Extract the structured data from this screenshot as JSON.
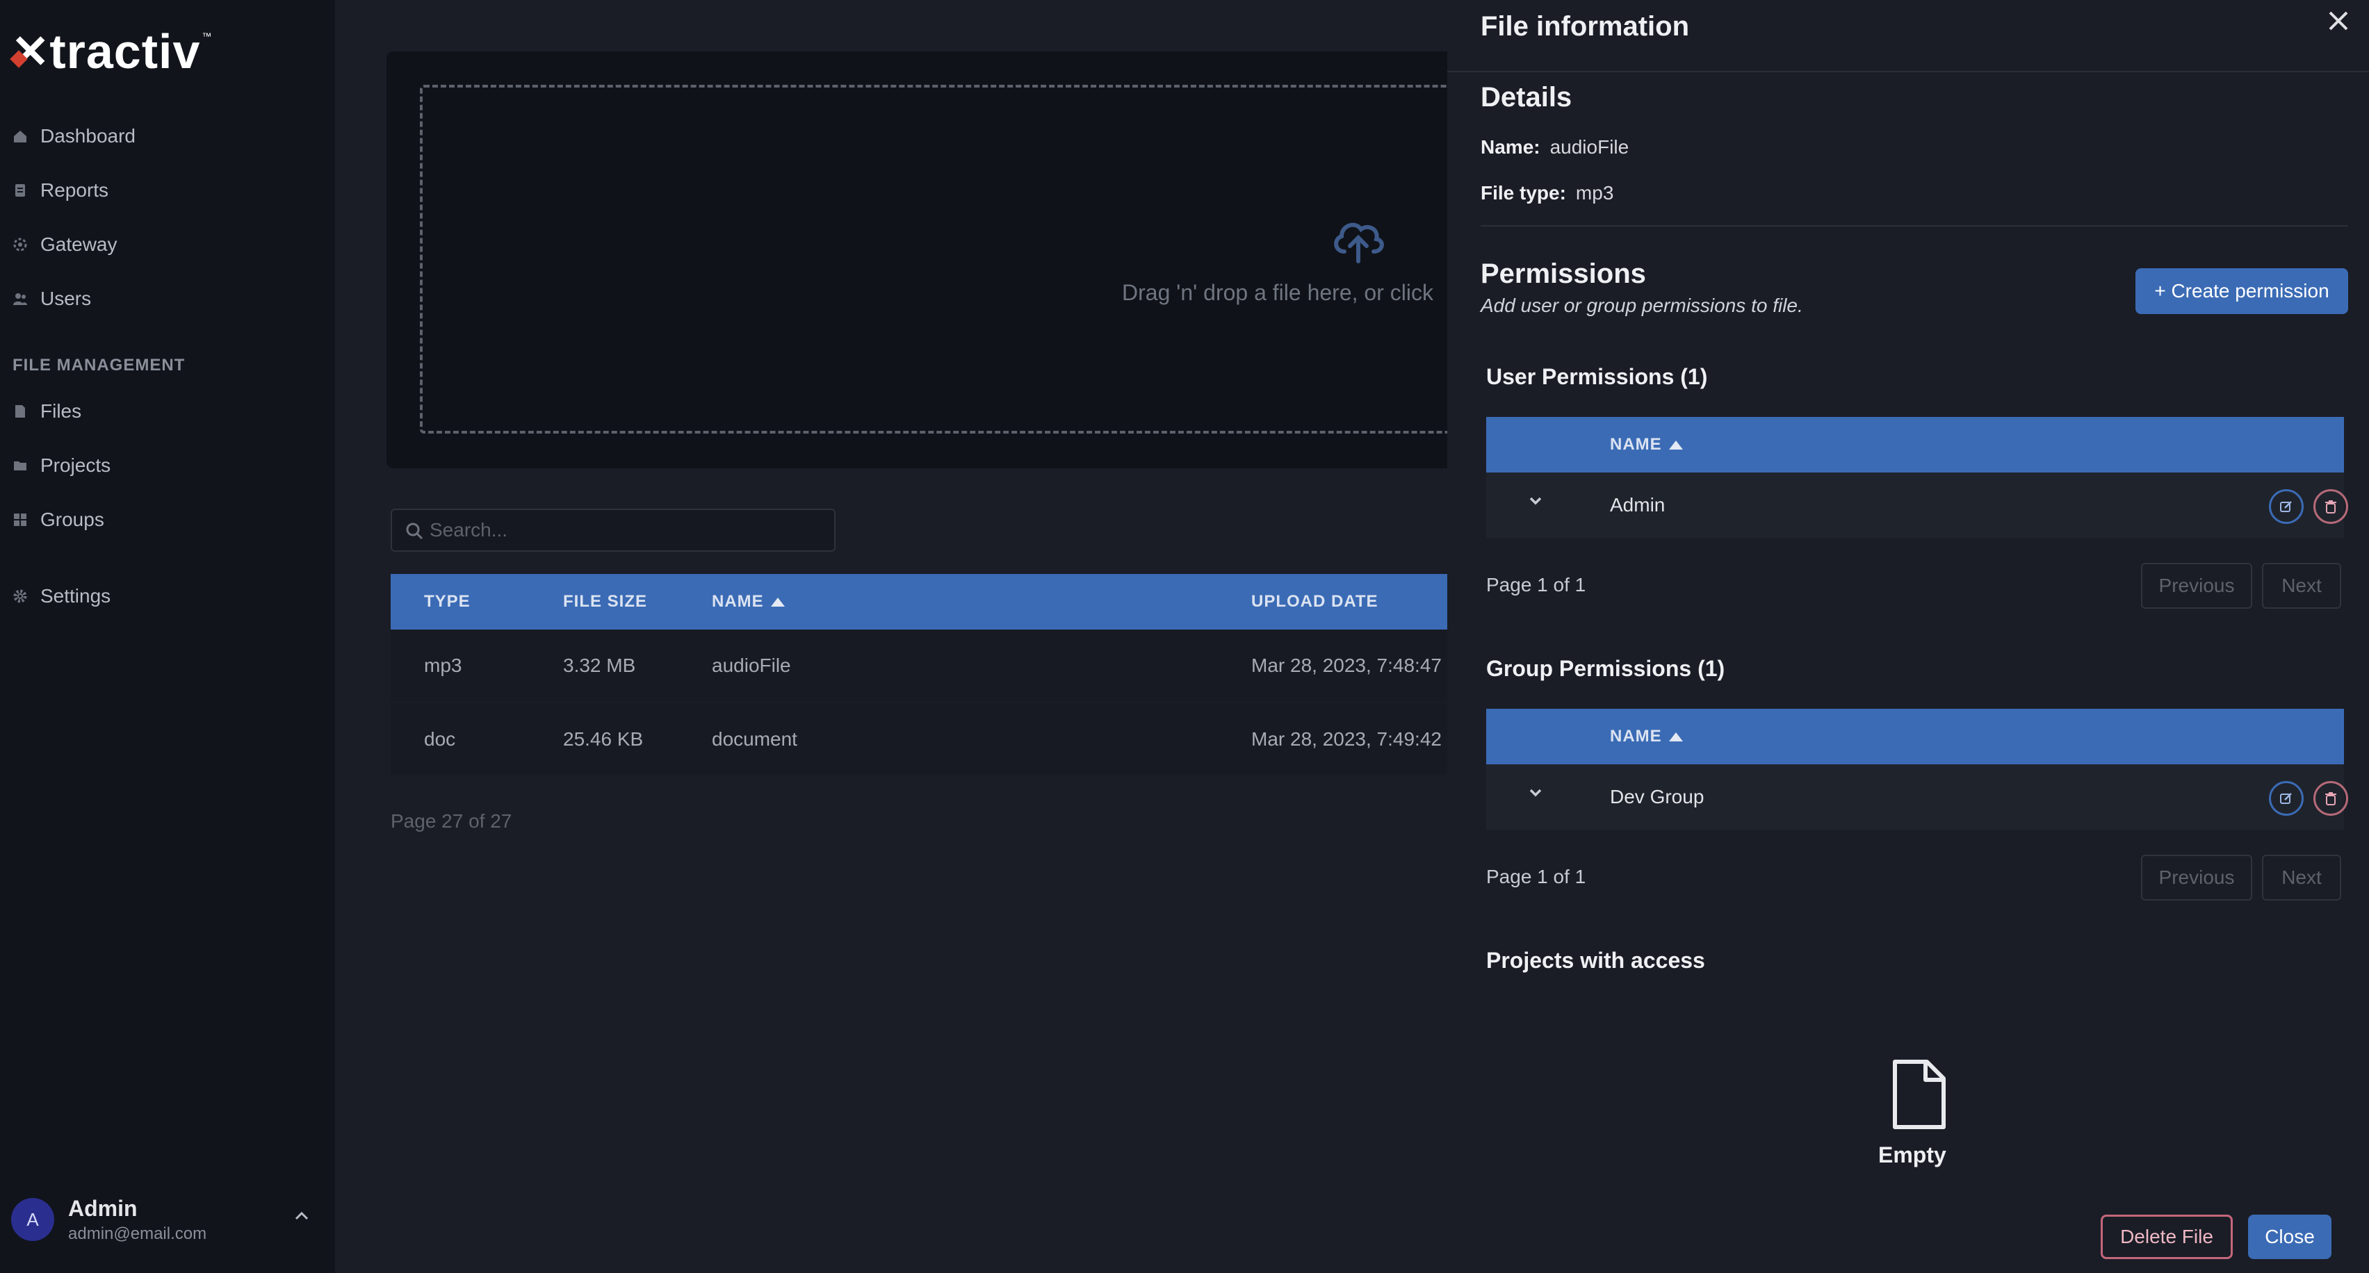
{
  "brand": {
    "name": "tractiv",
    "tm": "™"
  },
  "sidebar": {
    "items": [
      {
        "label": "Dashboard",
        "icon": "home-icon"
      },
      {
        "label": "Reports",
        "icon": "report-icon"
      },
      {
        "label": "Gateway",
        "icon": "gateway-icon"
      },
      {
        "label": "Users",
        "icon": "users-icon"
      }
    ],
    "section_label": "FILE MANAGEMENT",
    "file_items": [
      {
        "label": "Files",
        "icon": "file-icon"
      },
      {
        "label": "Projects",
        "icon": "folder-icon"
      },
      {
        "label": "Groups",
        "icon": "grid-icon"
      }
    ],
    "settings": {
      "label": "Settings",
      "icon": "gear-icon"
    },
    "user": {
      "initial": "A",
      "name": "Admin",
      "email": "admin@email.com"
    }
  },
  "dropzone": {
    "text": "Drag 'n' drop a file here, or click"
  },
  "search": {
    "placeholder": "Search..."
  },
  "files_table": {
    "columns": [
      "TYPE",
      "FILE SIZE",
      "NAME",
      "UPLOAD DATE"
    ],
    "rows": [
      {
        "type": "mp3",
        "size": "3.32 MB",
        "name": "audioFile",
        "date": "Mar 28, 2023, 7:48:47"
      },
      {
        "type": "doc",
        "size": "25.46 KB",
        "name": "document",
        "date": "Mar 28, 2023, 7:49:42"
      }
    ],
    "page_label": "Page 27 of 27"
  },
  "panel": {
    "title": "File information",
    "details_title": "Details",
    "name_label": "Name:",
    "name_value": "audioFile",
    "type_label": "File type:",
    "type_value": "mp3",
    "permissions_title": "Permissions",
    "permissions_subtitle": "Add user or group permissions to file.",
    "create_button": "+ Create permission",
    "user_permissions": {
      "title": "User Permissions (1)",
      "column": "NAME",
      "rows": [
        "Admin"
      ],
      "page_label": "Page 1 of 1",
      "prev": "Previous",
      "next": "Next"
    },
    "group_permissions": {
      "title": "Group Permissions (1)",
      "column": "NAME",
      "rows": [
        "Dev Group"
      ],
      "page_label": "Page 1 of 1",
      "prev": "Previous",
      "next": "Next"
    },
    "projects_title": "Projects with access",
    "empty_label": "Empty",
    "delete_button": "Delete File",
    "close_button": "Close"
  }
}
